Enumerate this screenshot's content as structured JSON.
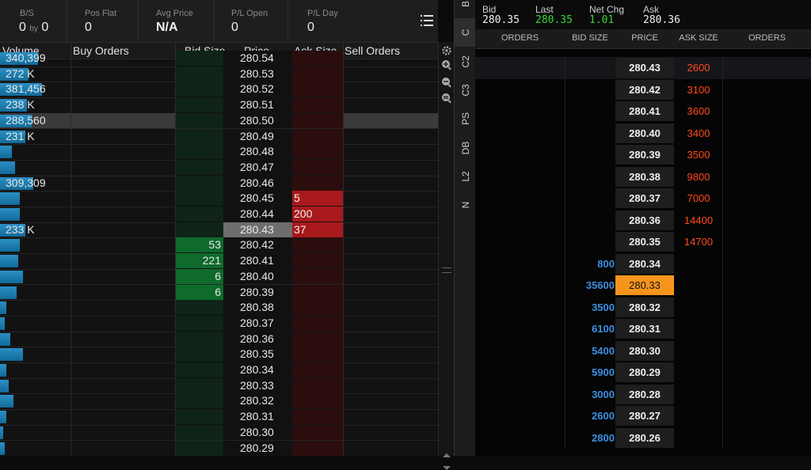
{
  "left_panel": {
    "header": {
      "bs": {
        "label": "B/S",
        "buy": "0",
        "by": "by",
        "sell": "0"
      },
      "pos_flat": {
        "label": "Pos Flat",
        "value": "0"
      },
      "avg_price": {
        "label": "Avg Price",
        "value": "N/A"
      },
      "pl_open": {
        "label": "P/L Open",
        "value": "0"
      },
      "pl_day": {
        "label": "P/L Day",
        "value": "0"
      }
    },
    "columns": {
      "volume": "Volume",
      "buy_orders": "Buy Orders",
      "bid_size": "Bid Size",
      "price": "Price",
      "ask_size": "Ask Size",
      "sell_orders": "Sell Orders"
    },
    "rows": [
      {
        "price": "280.54",
        "volume_label": "340,399",
        "volume": 0.23,
        "bid": "",
        "ask": ""
      },
      {
        "price": "280.53",
        "volume_label": "272 K",
        "volume": 0.17,
        "bid": "",
        "ask": ""
      },
      {
        "price": "280.52",
        "volume_label": "381,456",
        "volume": 0.25,
        "bid": "",
        "ask": ""
      },
      {
        "price": "280.51",
        "volume_label": "238 K",
        "volume": 0.16,
        "bid": "",
        "ask": ""
      },
      {
        "price": "280.50",
        "volume_label": "288,560",
        "volume": 0.19,
        "bid": "",
        "ask": "",
        "selected": true
      },
      {
        "price": "280.49",
        "volume_label": "231 K",
        "volume": 0.15,
        "bid": "",
        "ask": ""
      },
      {
        "price": "280.48",
        "volume_label": "",
        "volume": 0.07,
        "bid": "",
        "ask": ""
      },
      {
        "price": "280.47",
        "volume_label": "",
        "volume": 0.09,
        "bid": "",
        "ask": ""
      },
      {
        "price": "280.46",
        "volume_label": "309,309",
        "volume": 0.2,
        "bid": "",
        "ask": ""
      },
      {
        "price": "280.45",
        "volume_label": "",
        "volume": 0.12,
        "bid": "",
        "ask": "5"
      },
      {
        "price": "280.44",
        "volume_label": "",
        "volume": 0.12,
        "bid": "",
        "ask": "200"
      },
      {
        "price": "280.43",
        "volume_label": "233 K",
        "volume": 0.15,
        "bid": "",
        "ask": "37",
        "current": true
      },
      {
        "price": "280.42",
        "volume_label": "",
        "volume": 0.12,
        "bid": "53",
        "ask": ""
      },
      {
        "price": "280.41",
        "volume_label": "",
        "volume": 0.11,
        "bid": "221",
        "ask": ""
      },
      {
        "price": "280.40",
        "volume_label": "",
        "volume": 0.14,
        "bid": "6",
        "ask": ""
      },
      {
        "price": "280.39",
        "volume_label": "",
        "volume": 0.1,
        "bid": "6",
        "ask": ""
      },
      {
        "price": "280.38",
        "volume_label": "",
        "volume": 0.04,
        "bid": "",
        "ask": ""
      },
      {
        "price": "280.37",
        "volume_label": "",
        "volume": 0.03,
        "bid": "",
        "ask": ""
      },
      {
        "price": "280.36",
        "volume_label": "",
        "volume": 0.06,
        "bid": "",
        "ask": ""
      },
      {
        "price": "280.35",
        "volume_label": "",
        "volume": 0.14,
        "bid": "",
        "ask": ""
      },
      {
        "price": "280.34",
        "volume_label": "",
        "volume": 0.04,
        "bid": "",
        "ask": ""
      },
      {
        "price": "280.33",
        "volume_label": "",
        "volume": 0.05,
        "bid": "",
        "ask": ""
      },
      {
        "price": "280.32",
        "volume_label": "",
        "volume": 0.08,
        "bid": "",
        "ask": ""
      },
      {
        "price": "280.31",
        "volume_label": "",
        "volume": 0.04,
        "bid": "",
        "ask": ""
      },
      {
        "price": "280.30",
        "volume_label": "",
        "volume": 0.02,
        "bid": "",
        "ask": ""
      },
      {
        "price": "280.29",
        "volume_label": "",
        "volume": 0.03,
        "bid": "",
        "ask": ""
      }
    ]
  },
  "tabs": [
    "B",
    "C",
    "C2",
    "C3",
    "PS",
    "DB",
    "L2",
    "N"
  ],
  "active_tab": "C",
  "right_panel": {
    "quote": {
      "bid_label": "Bid",
      "bid": "280.35",
      "last_label": "Last",
      "last": "280.35",
      "netchg_label": "Net Chg",
      "netchg": "1.01",
      "ask_label": "Ask",
      "ask": "280.36"
    },
    "columns": {
      "orders_buy": "ORDERS",
      "bid_size": "BID SIZE",
      "price": "PRICE",
      "ask_size": "ASK SIZE",
      "orders_sell": "ORDERS"
    },
    "rows": [
      {
        "price": "280.43",
        "bid": "",
        "ask": "2600"
      },
      {
        "price": "280.42",
        "bid": "",
        "ask": "3100"
      },
      {
        "price": "280.41",
        "bid": "",
        "ask": "3600"
      },
      {
        "price": "280.40",
        "bid": "",
        "ask": "3400"
      },
      {
        "price": "280.39",
        "bid": "",
        "ask": "3500"
      },
      {
        "price": "280.38",
        "bid": "",
        "ask": "9800"
      },
      {
        "price": "280.37",
        "bid": "",
        "ask": "7000"
      },
      {
        "price": "280.36",
        "bid": "",
        "ask": "14400"
      },
      {
        "price": "280.35",
        "bid": "",
        "ask": "14700"
      },
      {
        "price": "280.34",
        "bid": "800",
        "ask": ""
      },
      {
        "price": "280.33",
        "bid": "35600",
        "ask": "",
        "current": true
      },
      {
        "price": "280.32",
        "bid": "3500",
        "ask": ""
      },
      {
        "price": "280.31",
        "bid": "6100",
        "ask": ""
      },
      {
        "price": "280.30",
        "bid": "5400",
        "ask": ""
      },
      {
        "price": "280.29",
        "bid": "5900",
        "ask": ""
      },
      {
        "price": "280.28",
        "bid": "3000",
        "ask": ""
      },
      {
        "price": "280.27",
        "bid": "2600",
        "ask": ""
      },
      {
        "price": "280.26",
        "bid": "2800",
        "ask": ""
      }
    ]
  },
  "colors": {
    "bid_green": "#0e6b2b",
    "ask_red": "#a8191b",
    "volume_blue": "#1b7bb0",
    "right_bid": "#3d8fe0",
    "right_ask": "#ff4a1a",
    "last_green": "#36d636",
    "current_price_orange": "#f7941d"
  },
  "icons": [
    "menu-icon",
    "gear-icon",
    "zoom-in-icon",
    "zoom-out-icon",
    "zoom-reset-icon",
    "scroll-up-icon",
    "scroll-down-icon"
  ]
}
